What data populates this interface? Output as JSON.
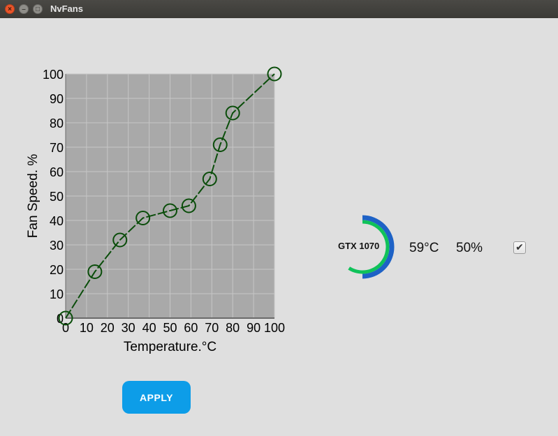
{
  "window": {
    "title": "NvFans",
    "close_glyph": "×",
    "minimize_glyph": "–",
    "maximize_glyph": "□"
  },
  "gpu": {
    "name": "GTX 1070",
    "temperature": "59°C",
    "fan_speed": "50%",
    "enabled_glyph": "✔",
    "gauge_outer_fraction": 0.5,
    "gauge_inner_fraction": 0.59,
    "colors": {
      "outer": "#1e62c6",
      "inner": "#10c25a"
    }
  },
  "apply_label": "APPLY",
  "chart_data": {
    "type": "line",
    "xlabel": "Temperature.°C",
    "ylabel": "Fan Speed. %",
    "xlim": [
      0,
      100
    ],
    "ylim": [
      0,
      100
    ],
    "xticks": [
      "0",
      "10",
      "20",
      "30",
      "40",
      "50",
      "60",
      "70",
      "80",
      "90",
      "100"
    ],
    "yticks": [
      "0",
      "10",
      "20",
      "30",
      "40",
      "50",
      "60",
      "70",
      "80",
      "90",
      "100"
    ],
    "grid": true,
    "series": [
      {
        "x": [
          0,
          14,
          26,
          37,
          50,
          59,
          69,
          74,
          80,
          100
        ],
        "y": [
          0,
          19,
          32,
          41,
          44,
          46,
          57,
          71,
          84,
          100
        ]
      }
    ],
    "colors": {
      "plot_bg": "#a9a9a9",
      "grid": "#c6c6c6",
      "line": "#0a4d0a"
    }
  }
}
